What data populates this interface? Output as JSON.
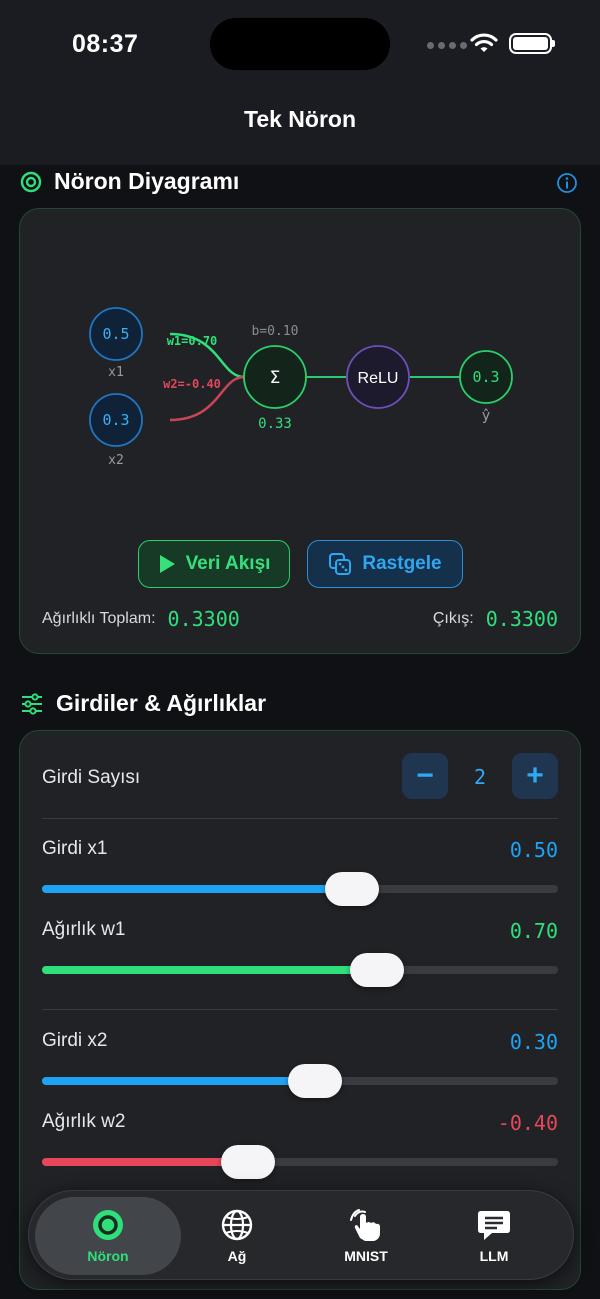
{
  "status_bar": {
    "time": "08:37"
  },
  "header": {
    "title": "Tek Nöron"
  },
  "diagram_section": {
    "title": "Nöron Diyagramı",
    "icon": "target-icon",
    "info_icon": "info-icon",
    "nodes": {
      "x1_value": "0.5",
      "x1_label": "x1",
      "x2_value": "0.3",
      "x2_label": "x2",
      "sum_symbol": "Σ",
      "sum_value": "0.33",
      "bias_label": "b=0.10",
      "activation": "ReLU",
      "output_value": "0.3",
      "output_label": "ŷ"
    },
    "edges": {
      "w1_label": "w1=0.70",
      "w2_label": "w2=-0.40"
    },
    "buttons": {
      "flow_label": "Veri Akışı",
      "random_label": "Rastgele"
    },
    "weighted_sum_label": "Ağırlıklı Toplam:",
    "weighted_sum_value": "0.3300",
    "output_label": "Çıkış:",
    "output_value": "0.3300"
  },
  "inputs_section": {
    "title": "Girdiler & Ağırlıklar",
    "icon": "sliders-icon",
    "input_count_label": "Girdi Sayısı",
    "input_count": "2",
    "minus_label": "−",
    "plus_label": "+",
    "rows": [
      {
        "label": "Girdi x1",
        "value": "0.50",
        "fraction": 0.6,
        "color": "#1fa3f5"
      },
      {
        "label": "Ağırlık w1",
        "value": "0.70",
        "fraction": 0.65,
        "color": "#2fe07a"
      },
      {
        "label": "Girdi x2",
        "value": "0.30",
        "fraction": 0.53,
        "color": "#1fa3f5"
      },
      {
        "label": "Ağırlık w2",
        "value": "-0.40",
        "fraction": 0.4,
        "color": "#e8475a"
      }
    ]
  },
  "tab_bar": {
    "tabs": [
      {
        "label": "Nöron",
        "icon": "neuron-icon",
        "active": true
      },
      {
        "label": "Ağ",
        "icon": "globe-icon",
        "active": false
      },
      {
        "label": "MNIST",
        "icon": "hand-tap-icon",
        "active": false
      },
      {
        "label": "LLM",
        "icon": "chat-bubble-icon",
        "active": false
      }
    ]
  },
  "colors": {
    "accent_green": "#2fe07a",
    "accent_blue": "#1fa3f5",
    "negative_red": "#e8475a",
    "background": "#101114",
    "card": "#212226"
  }
}
